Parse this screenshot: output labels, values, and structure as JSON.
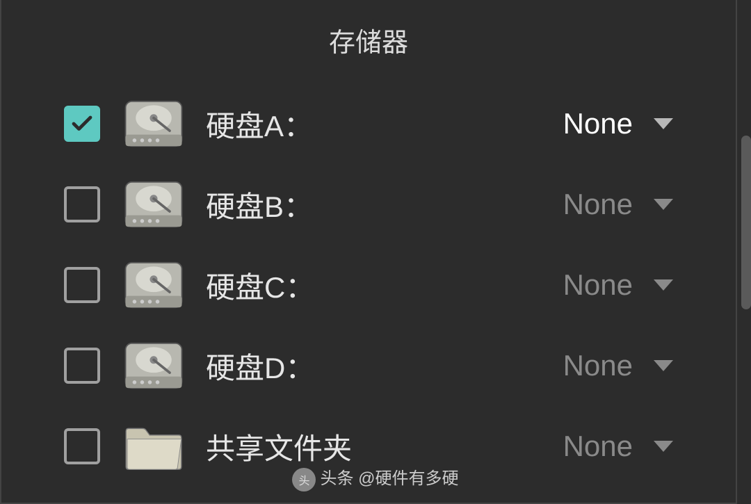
{
  "title": "存储器",
  "accent_color": "#5ec9c1",
  "storage": {
    "items": [
      {
        "label": "硬盘A：",
        "checked": true,
        "icon": "hdd",
        "value": "None",
        "active": true
      },
      {
        "label": "硬盘B：",
        "checked": false,
        "icon": "hdd",
        "value": "None",
        "active": false
      },
      {
        "label": "硬盘C：",
        "checked": false,
        "icon": "hdd",
        "value": "None",
        "active": false
      },
      {
        "label": "硬盘D：",
        "checked": false,
        "icon": "hdd",
        "value": "None",
        "active": false
      },
      {
        "label": "共享文件夹",
        "checked": false,
        "icon": "folder",
        "value": "None",
        "active": false
      }
    ]
  },
  "watermark": "头条 @硬件有多硬"
}
